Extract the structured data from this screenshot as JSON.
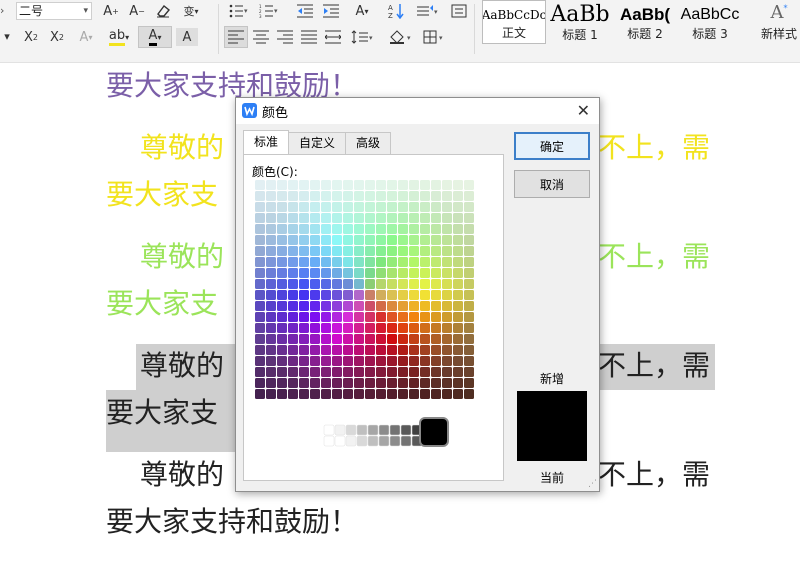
{
  "ribbon": {
    "font_size_value": "二号",
    "styles": [
      {
        "name": "正文",
        "sample": "AaBbCcDc"
      },
      {
        "name": "标题 1",
        "sample": "AaBb"
      },
      {
        "name": "标题 2",
        "sample": "AaBb("
      },
      {
        "name": "标题 3",
        "sample": "AaBbCc"
      }
    ],
    "new_style_label": "新样式",
    "colors": {
      "accent": "#2d7ff5"
    }
  },
  "document": {
    "lines": [
      {
        "text": "要大家支持和鼓励！",
        "color": "#7b5fa8"
      },
      {
        "text": "尊敬的",
        "color": "#f2e31e"
      },
      {
        "text": "不上，需",
        "color": "#f2e31e"
      },
      {
        "text": "要大家支",
        "color": "#f2e31e"
      },
      {
        "text": "尊敬的",
        "color": "#9be45a"
      },
      {
        "text": "不上，需",
        "color": "#9be45a"
      },
      {
        "text": "要大家支",
        "color": "#9be45a"
      },
      {
        "text": "尊敬的",
        "color": "#222222"
      },
      {
        "text": "不上，需",
        "color": "#222222"
      },
      {
        "text": "要大家支",
        "color": "#222222"
      },
      {
        "text": "尊敬的",
        "color": "#222222"
      },
      {
        "text": "不上，需",
        "color": "#222222"
      },
      {
        "text": "要大家支持和鼓励！",
        "color": "#222222"
      }
    ]
  },
  "dialog": {
    "title": "颜色",
    "tabs": [
      {
        "label": "标准",
        "active": true
      },
      {
        "label": "自定义",
        "active": false
      },
      {
        "label": "高级",
        "active": false
      }
    ],
    "colors_label": "颜色(C):",
    "ok_label": "确定",
    "cancel_label": "取消",
    "new_label": "新增",
    "current_label": "当前",
    "preview_color": "#000000"
  }
}
